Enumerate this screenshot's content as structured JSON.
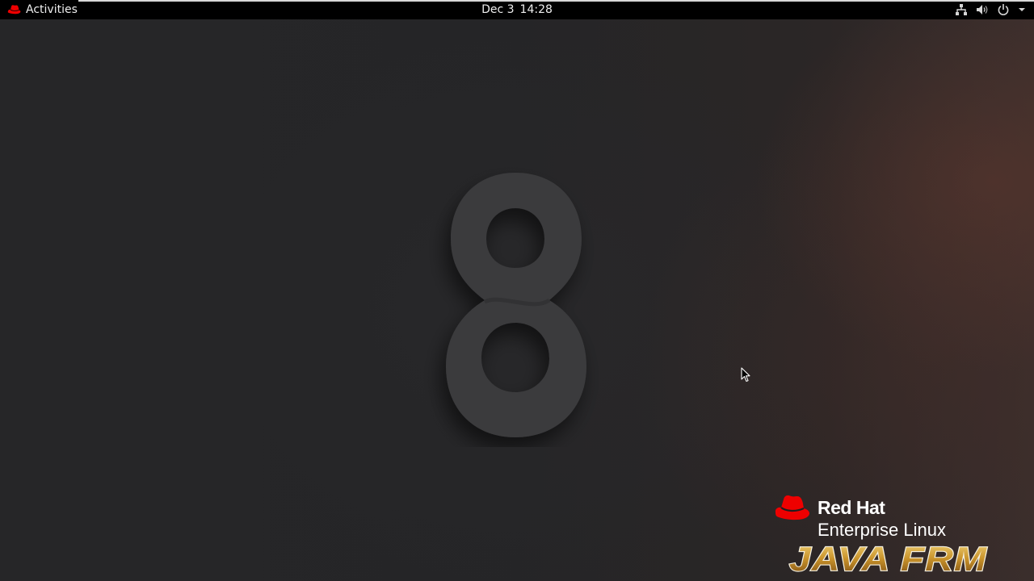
{
  "topbar": {
    "activities_label": "Activities",
    "date": "Dec 3",
    "time": "14:28",
    "tray_icons": [
      "network-icon",
      "volume-icon",
      "power-icon",
      "chevron-down-icon"
    ]
  },
  "desktop": {
    "wallpaper_numeral": "8",
    "logo": {
      "brand": "Red Hat",
      "product": "Enterprise Linux",
      "watermark": "JAVA FRM"
    }
  },
  "colors": {
    "brand_red": "#ee0000",
    "topbar_bg": "#000000",
    "desktop_bg": "#252527"
  }
}
